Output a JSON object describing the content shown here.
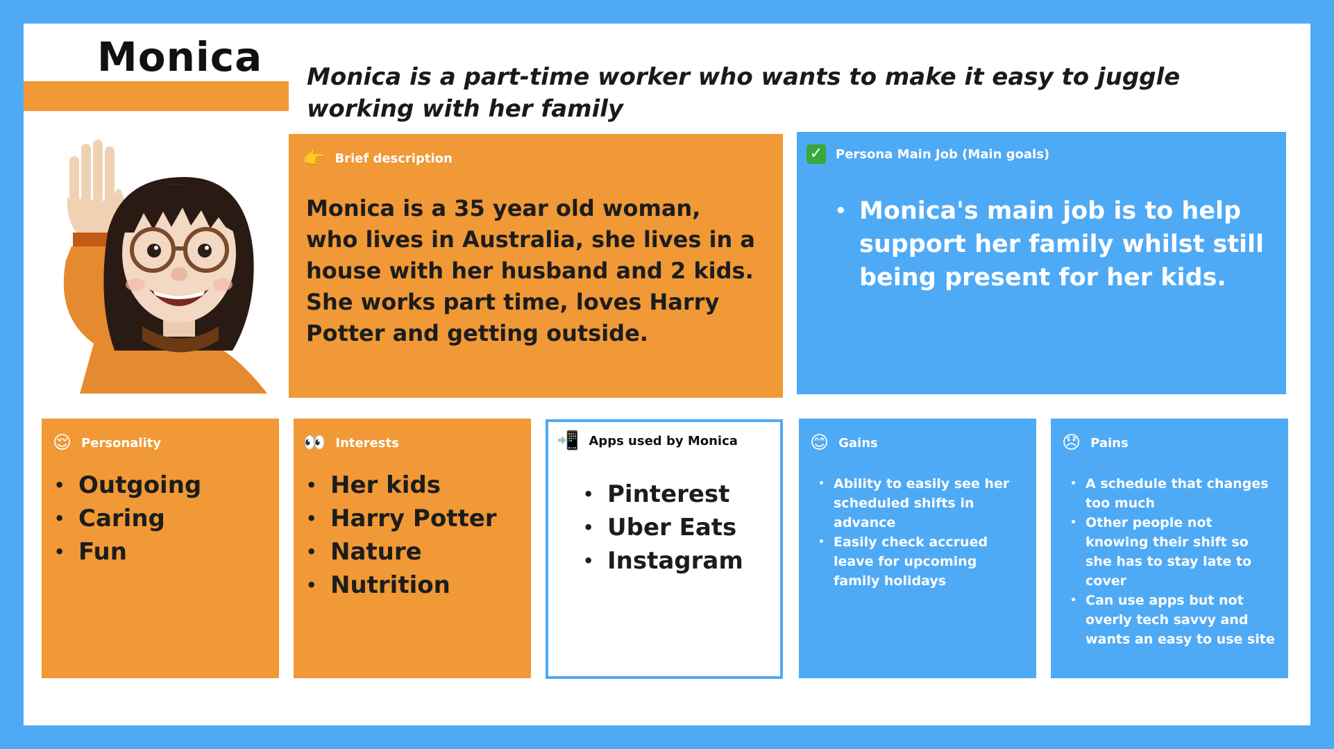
{
  "persona": {
    "name": "Monica",
    "tagline": "Monica is a part-time worker who wants to make it easy to juggle working with her family"
  },
  "brief": {
    "icon": "pointing-hand-icon",
    "heading": "Brief description",
    "text": "Monica is a 35 year old woman, who lives in Australia, she lives in a house with her husband and 2 kids. She works part time, loves Harry Potter and getting outside."
  },
  "goals": {
    "icon": "check-mark-icon",
    "heading": "Persona Main Job (Main goals)",
    "items": [
      "Monica's main job is to help support her family whilst still being present for her kids."
    ]
  },
  "personality": {
    "icon": "relieved-face-icon",
    "heading": "Personality",
    "items": [
      "Outgoing",
      "Caring",
      "Fun"
    ]
  },
  "interests": {
    "icon": "eyes-icon",
    "heading": "Interests",
    "items": [
      "Her kids",
      "Harry Potter",
      "Nature",
      "Nutrition"
    ]
  },
  "apps": {
    "icon": "mobile-phone-icon",
    "heading": "Apps used by Monica",
    "items": [
      "Pinterest",
      "Uber Eats",
      "Instagram"
    ]
  },
  "gains": {
    "icon": "smiling-face-icon",
    "heading": "Gains",
    "items": [
      "Ability to easily see her scheduled shifts in advance",
      "Easily check accrued leave for upcoming family holidays"
    ]
  },
  "pains": {
    "icon": "disappointed-face-icon",
    "heading": "Pains",
    "items": [
      "A schedule that changes too much",
      "Other people not knowing their shift so she has to stay late to cover",
      "Can use apps but not overly tech savvy and wants an easy to use site"
    ]
  },
  "colors": {
    "orange": "#f09936",
    "blue": "#4faaf5",
    "white": "#ffffff"
  }
}
